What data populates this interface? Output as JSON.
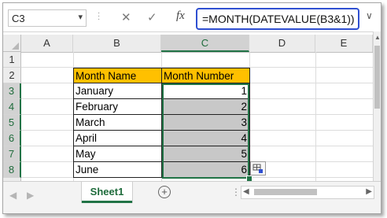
{
  "name_box": "C3",
  "formula_bar": {
    "cancel_icon": "x-icon",
    "enter_icon": "check-icon",
    "fx_label": "fx",
    "formula": "=MONTH(DATEVALUE(B3&1))"
  },
  "columns": [
    "A",
    "B",
    "C",
    "D",
    "E"
  ],
  "rows": [
    "1",
    "2",
    "3",
    "4",
    "5",
    "6",
    "7",
    "8"
  ],
  "table": {
    "headers": [
      "Month Name",
      "Month Number"
    ],
    "rows": [
      {
        "name": "January",
        "number": "1"
      },
      {
        "name": "February",
        "number": "2"
      },
      {
        "name": "March",
        "number": "3"
      },
      {
        "name": "April",
        "number": "4"
      },
      {
        "name": "May",
        "number": "5"
      },
      {
        "name": "June",
        "number": "6"
      }
    ]
  },
  "sheet_tab": "Sheet1",
  "colors": {
    "header_fill": "#ffc000",
    "selection_fill": "#c8c8c8",
    "excel_green": "#217346",
    "formula_border": "#2f4fd1"
  }
}
